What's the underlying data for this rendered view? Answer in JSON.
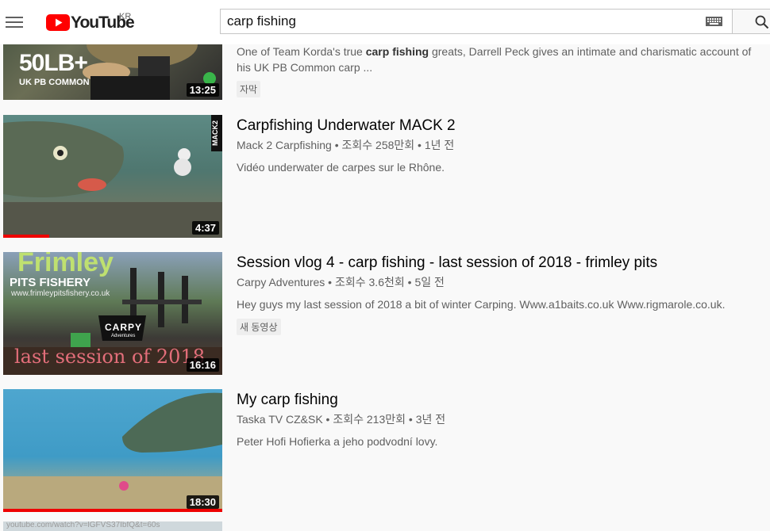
{
  "header": {
    "logo_text": "YouTube",
    "region": "KR",
    "search_value": "carp fishing"
  },
  "results": [
    {
      "thumb_text_line1": "50LB+",
      "thumb_text_line2": "UK PB COMMON",
      "duration": "13:25",
      "desc_pre": "One of Team Korda's true ",
      "desc_bold": "carp fishing",
      "desc_post": " greats, Darrell Peck gives an intimate and charismatic account of his UK PB Common carp ...",
      "badge": "자막"
    },
    {
      "thumb_label": "MACK2",
      "duration": "4:37",
      "progress": 0.21,
      "title": "Carpfishing Underwater MACK 2",
      "channel": "Mack 2 Carpfishing",
      "views": "조회수 258만회",
      "age": "1년 전",
      "desc": "Vidéo underwater de carpes sur le Rhône."
    },
    {
      "thumb_text_top": "Frimley",
      "thumb_text_sub": "PITS FISHERY",
      "thumb_text_url": "www.frimleypitsfishery.co.uk",
      "thumb_brand": "CARPY",
      "thumb_brand_sub": "Adventures",
      "thumb_text_bottom": "last session of 2018",
      "duration": "16:16",
      "title": "Session vlog 4 - carp fishing - last session of 2018 - frimley pits",
      "channel": "Carpy Adventures",
      "views": "조회수 3.6천회",
      "age": "5일 전",
      "desc": "Hey guys my last session of 2018 a bit of winter Carping. Www.a1baits.co.uk Www.rigmarole.co.uk.",
      "badge": "새 동영상"
    },
    {
      "duration": "18:30",
      "progress": 1.0,
      "title": "My carp fishing",
      "channel": "Taska TV CZ&SK",
      "views": "조회수 213만회",
      "age": "3년 전",
      "desc": "Peter Hofi Hofierka a jeho podvodní lovy."
    }
  ],
  "status_url": "youtube.com/watch?v=lGFVS37IbfQ&t=60s",
  "colors": {
    "brand_red": "#ff0000",
    "progress_red": "#e00000",
    "text_secondary": "#606060"
  }
}
